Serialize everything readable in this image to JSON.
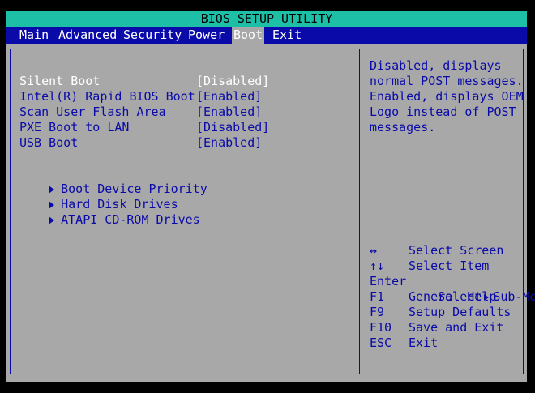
{
  "title": "BIOS SETUP UTILITY",
  "menu": [
    {
      "label": "Main",
      "active": false
    },
    {
      "label": "Advanced",
      "active": false
    },
    {
      "label": "Security",
      "active": false
    },
    {
      "label": "Power",
      "active": false
    },
    {
      "label": "Boot",
      "active": true
    },
    {
      "label": "Exit",
      "active": false
    }
  ],
  "options": [
    {
      "label": "Silent Boot",
      "value": "[Disabled]",
      "selected": true
    },
    {
      "label": "Intel(R) Rapid BIOS Boot",
      "value": "[Enabled]",
      "selected": false
    },
    {
      "label": "Scan User Flash Area",
      "value": "[Enabled]",
      "selected": false
    },
    {
      "label": "PXE Boot to LAN",
      "value": "[Disabled]",
      "selected": false
    },
    {
      "label": "USB Boot",
      "value": "[Enabled]",
      "selected": false
    }
  ],
  "submenus": [
    {
      "label": "Boot Device Priority"
    },
    {
      "label": "Hard Disk Drives"
    },
    {
      "label": "ATAPI CD-ROM Drives"
    }
  ],
  "help_lines": [
    "Disabled, displays",
    "normal POST messages.",
    "Enabled, displays OEM",
    "Logo instead of POST",
    "messages."
  ],
  "keys": [
    {
      "key": "↔",
      "desc": "Select Screen"
    },
    {
      "key": "↑↓",
      "desc": "Select Item"
    },
    {
      "key": "Enter",
      "desc_prefix": "Select",
      "desc_suffix": "Sub-Menu"
    },
    {
      "key": "F1",
      "desc": "General Help"
    },
    {
      "key": "F9",
      "desc": "Setup Defaults"
    },
    {
      "key": "F10",
      "desc": "Save and Exit"
    },
    {
      "key": "ESC",
      "desc": "Exit"
    }
  ],
  "colors": {
    "title_bg": "#1dbfa6",
    "menu_bg": "#0a0aa8",
    "panel_bg": "#a8a8a8",
    "text_blue": "#0a0aa8",
    "selected_text": "#ffffff"
  }
}
